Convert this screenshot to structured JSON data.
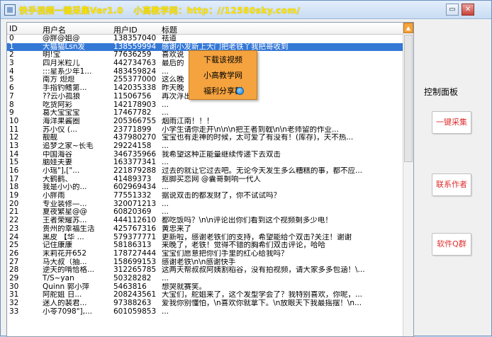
{
  "window": {
    "title": "快手视频一键采集Ver1.0",
    "site": "小高教学网：http：//12580sky.com/",
    "minimize_label": "▭",
    "close_label": "✕"
  },
  "table": {
    "columns": [
      "ID",
      "用户名",
      "用户ID",
      "标题"
    ],
    "rows": [
      [
        "0",
        "@胖@姐@",
        "138357040",
        "祛道"
      ],
      [
        "1",
        "大猫猫Lsn发",
        "138559994",
        "感谢小发新上大门把老铁丫我把哥收到"
      ],
      [
        "2",
        "明!宝",
        "77636259",
        "喜欢说"
      ],
      [
        "3",
        "四月米粒儿",
        "442734763",
        "最后的"
      ],
      [
        "4",
        ":::星系少年1...",
        "483459824",
        "..."
      ],
      [
        "5",
        "南方 炟炟",
        "255377000",
        "这么晚"
      ],
      [
        "6",
        "手指钓鳍第...",
        "142035338",
        "昨天晚"
      ],
      [
        "7",
        "??云小孤狼",
        "11506756",
        "再次浮出水面，持续更新"
      ],
      [
        "8",
        "吃货阿彩",
        "142178903",
        "..."
      ],
      [
        "9",
        "葛大宝宝宝",
        "17467782",
        "..."
      ],
      [
        "10",
        "海洋果酱圈",
        "205366755",
        "烟雨江南！！！"
      ],
      [
        "11",
        "苏小仪 (...",
        "23771899",
        "小学生请你走开\\n\\n\\n把王者到戟\\n\\n老师留的作业..."
      ],
      [
        "12",
        "靓靓",
        "437980270",
        "宝宝也有走神的时候，太可爱了有没有！(库存)，天不热..."
      ],
      [
        "13",
        "追梦之家~长毛",
        "29224158",
        "..."
      ],
      [
        "14",
        "中国海谷",
        "346735966",
        "我希望这种正能量继续传递下去双击"
      ],
      [
        "15",
        "脑娃夫妻",
        "163377341",
        "..."
      ],
      [
        "16",
        "小瑶\"],[\"...",
        "221879288",
        "过去的就让它过去吧。无论今天发生多么糟糕的事，都不应..."
      ],
      [
        "17",
        "大鹤鹤、",
        "41489373",
        "抠脚买恋网 @囊哥剩响一代人"
      ],
      [
        "18",
        "我是小小的...",
        "602969434",
        "..."
      ],
      [
        "19",
        "小胖雨",
        "77551332",
        "据说双击的都发财了，你不试试吗？"
      ],
      [
        "20",
        "专业装修—...",
        "320071213",
        "..."
      ],
      [
        "21",
        "夏夜繁星@@",
        "60820369",
        "..."
      ],
      [
        "22",
        "王者荣耀苏...",
        "444112610",
        "都吃饭吗？\\n\\n评论出你们看到这个视频剩多少电！"
      ],
      [
        "23",
        "贵州的幸福生活",
        "425767316",
        "黄忠来了"
      ],
      [
        "24",
        "黑皮 【华 ...",
        "579377771",
        "更新啦，感谢老铁们的支持，希望能给个双击?关注！谢谢"
      ],
      [
        "25",
        "记住康康",
        "58186313",
        "来晚了，老铁！觉得不错的胸希们双击评论，哈哈"
      ],
      [
        "26",
        "末莉花开652",
        "178727444",
        "宝宝们愿意把你们手里的红心给我吗？"
      ],
      [
        "27",
        "马大叔（抽...",
        "158699153",
        "感谢老铁\\n\\n感谢快手"
      ],
      [
        "28",
        "逆天的啃恰格...",
        "312265785",
        "这两天帮叔叔阿姨割稻谷，没有拍视频，请大家多多包涵！\\..."
      ],
      [
        "29",
        "T/S~yan",
        "50328282",
        "..."
      ],
      [
        "30",
        "Quinn 郭小萍",
        "5463816",
        "想哭就赛笑。"
      ],
      [
        "31",
        "阿舵姐 日...",
        "208243561",
        "大宝们，舵姐来了，这个发型学会了？我特别喜欢，你呢，..."
      ],
      [
        "32",
        "迷人的裴君...",
        "97388263",
        "爱我你别懂怕，\\n喜欢你就拿下。\\n放眼天下我最摇摆！\\n..."
      ],
      [
        "33",
        "小苓7098\"],...",
        "601059853",
        "..."
      ]
    ]
  },
  "context_menu": {
    "items": [
      "下载该视频",
      "小高教学网",
      "福利分享群"
    ]
  },
  "side_panel": {
    "title": "控制面板",
    "buttons": [
      "一键采集",
      "联系作者",
      "软件Q群"
    ]
  }
}
